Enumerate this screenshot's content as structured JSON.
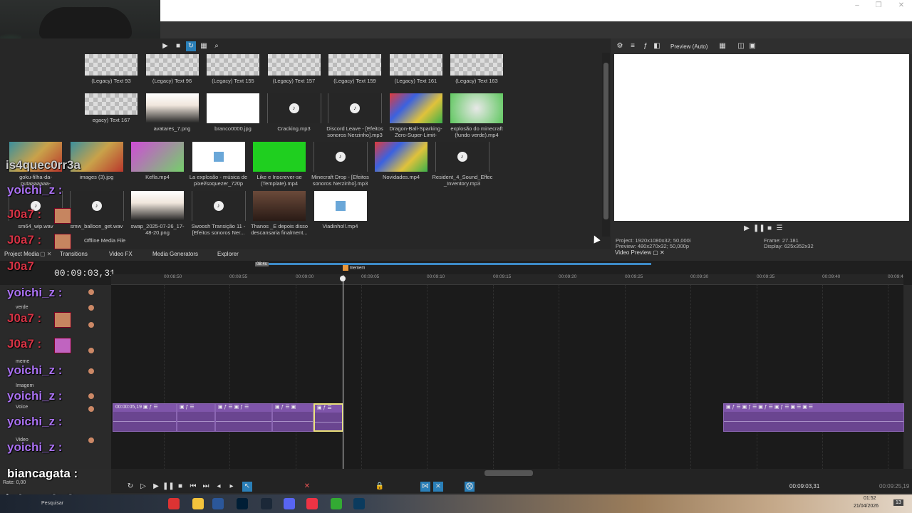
{
  "window": {
    "controls": [
      "–",
      "❐",
      "✕"
    ]
  },
  "media_toolbar": {
    "icons": [
      "play-icon",
      "stop-icon",
      "autopreview-icon",
      "views-icon",
      "zoom-icon"
    ]
  },
  "media": {
    "rows": [
      [
        {
          "label": "(Legacy) Text 93",
          "kind": "checker"
        },
        {
          "label": "(Legacy) Text 96",
          "kind": "checker"
        },
        {
          "label": "(Legacy) Text 155",
          "kind": "checker"
        },
        {
          "label": "(Legacy) Text 157",
          "kind": "checker"
        },
        {
          "label": "(Legacy) Text 159",
          "kind": "checker"
        },
        {
          "label": "(Legacy) Text 161",
          "kind": "checker"
        },
        {
          "label": "(Legacy) Text 163",
          "kind": "checker"
        }
      ],
      [
        {
          "label": "egacy) Text 167",
          "kind": "checker"
        },
        {
          "label": "avatares_7.png",
          "kind": "person"
        },
        {
          "label": "branco0000.jpg",
          "kind": "white"
        },
        {
          "label": "Cracking.mp3",
          "kind": "audio"
        },
        {
          "label": "Discord Leave - [Efeitos sonoros Nerzinho].mp3",
          "kind": "audio"
        },
        {
          "label": "Dragon-Ball-Sparking-Zero-Super-Limit-Breaking...",
          "kind": "colorful"
        },
        {
          "label": "explosão do minecraft (fundo verde).mp4",
          "kind": "greenish"
        }
      ],
      [
        {
          "label": "goku-filha-da-putaaaaaaa-svfromnet.com.mp4",
          "kind": "cartoon"
        },
        {
          "label": "images (3).jpg",
          "kind": "cartoon"
        },
        {
          "label": "Kefla.mp4",
          "kind": "pink"
        },
        {
          "label": "La explosão - música de pixel/soquezer_720p",
          "kind": "file"
        },
        {
          "label": "Like e Inscrever-se (Template).mp4",
          "kind": "green"
        },
        {
          "label": "Minecraft Drop - [Efeitos sonoros Nerzinho].mp3",
          "kind": "audio"
        },
        {
          "label": "Novidades.mp4",
          "kind": "colorful"
        },
        {
          "label": "Resident_4_Sound_Effects_-_Inventory.mp3",
          "kind": "audio"
        }
      ],
      [
        {
          "label": "sm64_wip.wav",
          "kind": "audio"
        },
        {
          "label": "smw_balloon_get.wav",
          "kind": "audio"
        },
        {
          "label": "swap_2025-07-26_17-48-20.png",
          "kind": "person"
        },
        {
          "label": "Swoosh Transição 11 - [Efeitos sonoros Ner...",
          "kind": "audio"
        },
        {
          "label": "Thanos _E depois disso descansaria finalment...",
          "kind": "dark"
        },
        {
          "label": "Viadinho!!.mp4",
          "kind": "file"
        }
      ]
    ],
    "offline_label": "Offline Media File"
  },
  "tabs": [
    "Project Media",
    "Transitions",
    "Video FX",
    "Media Generators",
    "Explorer"
  ],
  "preview": {
    "mode": "Preview (Auto)",
    "project": "Project:  1920x1080x32; 50,000i",
    "preview_res": "Preview:  480x270x32; 50,000p",
    "frame": "Frame:    27.181",
    "display": "Display:   625x352x32",
    "tab": "Video Preview"
  },
  "timeline": {
    "timecode": "00:09:03,31",
    "marker": "memem",
    "loop_label": "08:4s",
    "ticks": [
      "00:08:50",
      "00:08:55",
      "00:09:00",
      "00:09:05",
      "00:09:10",
      "00:09:15",
      "00:09:20",
      "00:09:25",
      "00:09:30",
      "00:09:35",
      "00:09:40",
      "00:09:4"
    ],
    "tracks": [
      "verde",
      "meme",
      "Imagem",
      "Voice",
      "Video"
    ],
    "clip_time": "00:00:05,19",
    "rate": "Rate: 0,00",
    "status_time": "00:09:03,31",
    "end_time": "00:09:25,19"
  },
  "chat": [
    {
      "name": "is4quec0rr3a",
      "color": "white"
    },
    {
      "name": "yoichi_z :",
      "color": "purple"
    },
    {
      "name": "J0a7 :",
      "color": "red"
    },
    {
      "name": "J0a7 :",
      "color": "red"
    },
    {
      "name": "J0a7",
      "color": "red"
    },
    {
      "name": "yoichi_z :",
      "color": "purple"
    },
    {
      "name": "J0a7 :",
      "color": "red"
    },
    {
      "name": "J0a7 :",
      "color": "red"
    },
    {
      "name": "yoichi_z :",
      "color": "purple"
    },
    {
      "name": "yoichi_z :",
      "color": "purple"
    },
    {
      "name": "yoichi_z :",
      "color": "purple"
    },
    {
      "name": "yoichi_z :",
      "color": "purple"
    },
    {
      "name": "biancagata :",
      "color": "white"
    },
    {
      "name": "is4quec0rr3a :",
      "color": "white"
    }
  ],
  "taskbar": {
    "search": "Pesquisar",
    "time": "01:52",
    "date": "21/04/2026",
    "badge": "13"
  }
}
